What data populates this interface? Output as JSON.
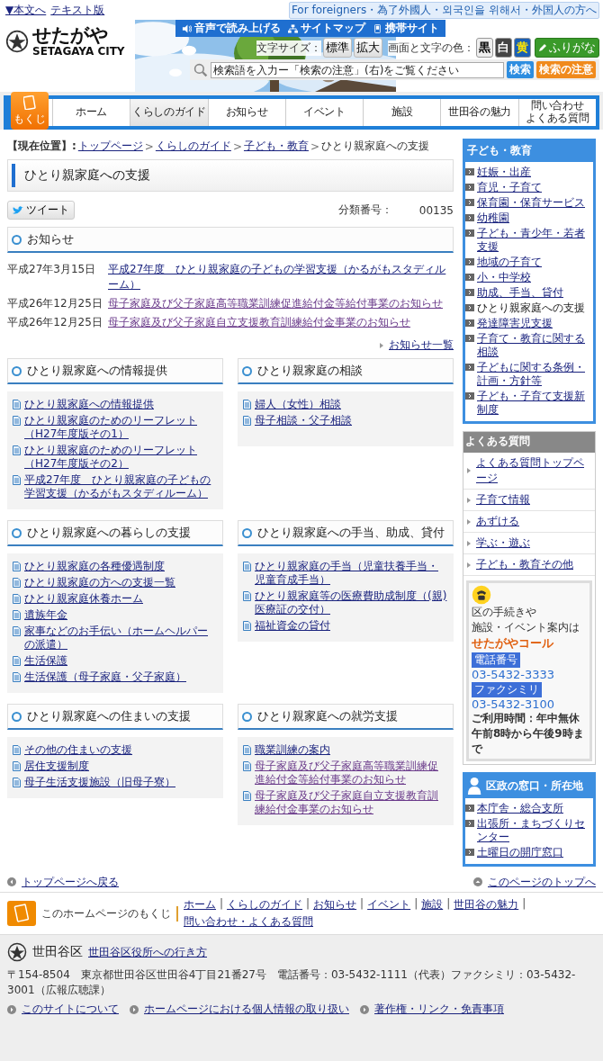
{
  "header": {
    "skip_links": [
      "▼本文へ",
      "テキスト版"
    ],
    "logo": {
      "name": "せたがや",
      "sub": "SETAGAYA CITY"
    },
    "tools": [
      {
        "label": "音声で読み上げる",
        "kind": "speaker"
      },
      {
        "label": "サイトマップ",
        "kind": "sitemap"
      },
      {
        "label": "携帯サイト",
        "kind": "phone"
      }
    ],
    "foreign_link": "For foreigners・為了外國人・외국인을 위해서・外国人の方へ",
    "font_size": {
      "label": "文字サイズ：",
      "buttons": [
        "標準",
        "拡大"
      ]
    },
    "colors": {
      "label": "画面と文字の色：",
      "buttons": [
        {
          "label": "黒",
          "kind": "black"
        },
        {
          "label": "白",
          "kind": "white"
        },
        {
          "label": "黄",
          "kind": "yellow"
        }
      ]
    },
    "furigana": "ふりがな",
    "search": {
      "placeholder": "検索語を入力ー「検索の注意」(右)をご覧ください",
      "button": "検索",
      "notes": "検索の注意"
    }
  },
  "nav": {
    "index_button": "もくじ",
    "items": [
      {
        "lines": [
          "ホーム"
        ],
        "selected": false
      },
      {
        "lines": [
          "くらしのガイド"
        ],
        "selected": true
      },
      {
        "lines": [
          "お知らせ"
        ],
        "selected": false
      },
      {
        "lines": [
          "イベント"
        ],
        "selected": false
      },
      {
        "lines": [
          "施設"
        ],
        "selected": false
      },
      {
        "lines": [
          "世田谷の魅力"
        ],
        "selected": false
      },
      {
        "lines": [
          "問い合わせ",
          "よくある質問"
        ],
        "selected": false
      }
    ]
  },
  "breadcrumb": {
    "label": "【現在位置】:",
    "separator": ">",
    "items": [
      {
        "label": "トップページ",
        "link": true
      },
      {
        "label": "くらしのガイド",
        "link": true
      },
      {
        "label": "子ども・教育",
        "link": true
      },
      {
        "label": "ひとり親家庭への支援",
        "link": false
      }
    ]
  },
  "title": "ひとり親家庭への支援",
  "tweet": "ツイート",
  "category": {
    "label": "分類番号：",
    "value": "00135"
  },
  "notices": {
    "heading": "お知らせ",
    "items": [
      {
        "date": "平成27年3月15日",
        "title": "平成27年度　ひとり親家庭の子どもの学習支援（かるがもスタディルーム）",
        "visited": false
      },
      {
        "date": "平成26年12月25日",
        "title": "母子家庭及び父子家庭高等職業訓練促進給付金等給付事業のお知らせ",
        "visited": true
      },
      {
        "date": "平成26年12月25日",
        "title": "母子家庭及び父子家庭自立支援教育訓練給付金事業のお知らせ",
        "visited": true
      }
    ],
    "more": "お知らせ一覧"
  },
  "sections": [
    {
      "heading": "ひとり親家庭への情報提供",
      "links": [
        {
          "label": "ひとり親家庭への情報提供",
          "visited": false
        },
        {
          "label": "ひとり親家庭のためのリーフレット（H27年度版その1）",
          "visited": false
        },
        {
          "label": "ひとり親家庭のためのリーフレット（H27年度版その2）",
          "visited": false
        },
        {
          "label": "平成27年度　ひとり親家庭の子どもの学習支援（かるがもスタディルーム）",
          "visited": false
        }
      ]
    },
    {
      "heading": "ひとり親家庭の相談",
      "links": [
        {
          "label": "婦人（女性）相談",
          "visited": false
        },
        {
          "label": "母子相談・父子相談",
          "visited": false
        }
      ]
    },
    {
      "heading": "ひとり親家庭への暮らしの支援",
      "links": [
        {
          "label": "ひとり親家庭の各種優遇制度",
          "visited": false
        },
        {
          "label": "ひとり親家庭の方への支援一覧",
          "visited": false
        },
        {
          "label": "ひとり親家庭休養ホーム",
          "visited": false
        },
        {
          "label": "遺族年金",
          "visited": false
        },
        {
          "label": "家事などのお手伝い（ホームヘルパーの派遣）",
          "visited": false
        },
        {
          "label": "生活保護",
          "visited": false
        },
        {
          "label": "生活保護（母子家庭・父子家庭）",
          "visited": false
        }
      ]
    },
    {
      "heading": "ひとり親家庭への手当、助成、貸付",
      "links": [
        {
          "label": "ひとり親家庭の手当（児童扶養手当・児童育成手当）",
          "visited": false
        },
        {
          "label": "ひとり親家庭等の医療費助成制度（(親)医療証の交付）",
          "visited": false
        },
        {
          "label": "福祉資金の貸付",
          "visited": false
        }
      ]
    },
    {
      "heading": "ひとり親家庭への住まいの支援",
      "links": [
        {
          "label": "その他の住まいの支援",
          "visited": false
        },
        {
          "label": "居住支援制度",
          "visited": false
        },
        {
          "label": "母子生活支援施設（旧母子寮）",
          "visited": false
        }
      ]
    },
    {
      "heading": "ひとり親家庭への就労支援",
      "links": [
        {
          "label": "職業訓練の案内",
          "visited": false
        },
        {
          "label": "母子家庭及び父子家庭高等職業訓練促進給付金等給付事業のお知らせ",
          "visited": true
        },
        {
          "label": "母子家庭及び父子家庭自立支援教育訓練給付金事業のお知らせ",
          "visited": true
        }
      ]
    }
  ],
  "back_links": [
    "トップページへ戻る",
    "このページのトップへ"
  ],
  "sidebar": {
    "category": {
      "heading": "子ども・教育",
      "items": [
        {
          "label": "妊娠・出産",
          "selected": false
        },
        {
          "label": "育児・子育て",
          "selected": false
        },
        {
          "label": "保育園・保育サービス",
          "selected": false
        },
        {
          "label": "幼稚園",
          "selected": false
        },
        {
          "label": "子ども・青少年・若者支援",
          "selected": false
        },
        {
          "label": "地域の子育て",
          "selected": false
        },
        {
          "label": "小・中学校",
          "selected": false
        },
        {
          "label": "助成、手当、貸付",
          "selected": false
        },
        {
          "label": "ひとり親家庭への支援",
          "selected": true
        },
        {
          "label": "発達障害児支援",
          "selected": false
        },
        {
          "label": "子育て・教育に関する相談",
          "selected": false
        },
        {
          "label": "子どもに関する条例・計画・方針等",
          "selected": false
        },
        {
          "label": "子ども・子育て支援新制度",
          "selected": false
        }
      ]
    },
    "faq": {
      "heading": "よくある質問",
      "items": [
        "よくある質問トップページ",
        "子育て情報",
        "あずける",
        "学ぶ・遊ぶ",
        "子ども・教育その他"
      ]
    },
    "call": {
      "lines": [
        "区の手続きや",
        "施設・イベント案内は"
      ],
      "name": "せたがやコール",
      "phone_label": "電話番号",
      "phone": "03-5432-3333",
      "fax_label": "ファクシミリ",
      "fax": "03-5432-3100",
      "hours": [
        "ご利用時間：年中無休",
        "午前8時から午後9時まで"
      ]
    },
    "office": {
      "heading": "区政の窓口・所在地",
      "items": [
        "本庁舎・総合支所",
        "出張所・まちづくりセンター",
        "土曜日の開庁窓口"
      ]
    }
  },
  "footer": {
    "index_label": "このホームページのもくじ",
    "separator": "|",
    "links": [
      "ホーム",
      "くらしのガイド",
      "お知らせ",
      "イベント",
      "施設",
      "世田谷の魅力",
      "問い合わせ・よくある質問"
    ],
    "city": "世田谷区",
    "access": "世田谷区役所への行き方",
    "address": "〒154-8504　東京都世田谷区世田谷4丁目21番27号　電話番号：03-5432-1111（代表）ファクシミリ：03-5432-3001（広報広聴課）",
    "bottom_links": [
      "このサイトについて",
      "ホームページにおける個人情報の取り扱い",
      "著作権・リンク・免責事項"
    ]
  }
}
